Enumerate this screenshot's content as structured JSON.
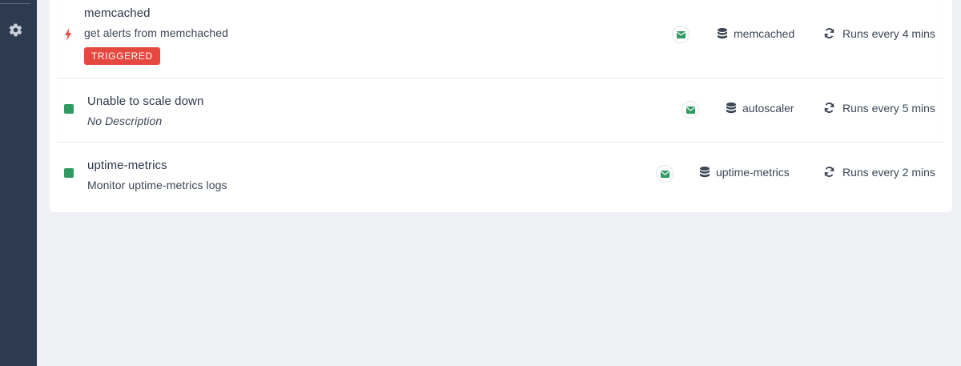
{
  "sidebar": {
    "settings_icon": "gear-icon"
  },
  "alerts": [
    {
      "title": "memcached",
      "description": "get alerts from memchached",
      "status": "triggered",
      "status_icon": "bolt-icon",
      "badge": "TRIGGERED",
      "notification_icon": "envelope-icon",
      "source": "memcached",
      "source_icon": "database-icon",
      "schedule": "Runs every 4 mins",
      "schedule_icon": "refresh-icon"
    },
    {
      "title": "Unable to scale down",
      "description": "No Description",
      "status": "ok",
      "status_icon": "green-square-icon",
      "notification_icon": "envelope-icon",
      "source": "autoscaler",
      "source_icon": "database-icon",
      "schedule": "Runs every 5 mins",
      "schedule_icon": "refresh-icon"
    },
    {
      "title": "uptime-metrics",
      "description": "Monitor uptime-metrics logs",
      "status": "ok",
      "status_icon": "green-square-icon",
      "notification_icon": "envelope-icon",
      "source": "uptime-metrics",
      "source_icon": "database-icon",
      "schedule": "Runs every 2 mins",
      "schedule_icon": "refresh-icon"
    }
  ],
  "colors": {
    "sidebar": "#2d3a4f",
    "background": "#eff1f5",
    "triggered": "#e5483f",
    "ok": "#2f9b62",
    "text": "#2d3748"
  }
}
